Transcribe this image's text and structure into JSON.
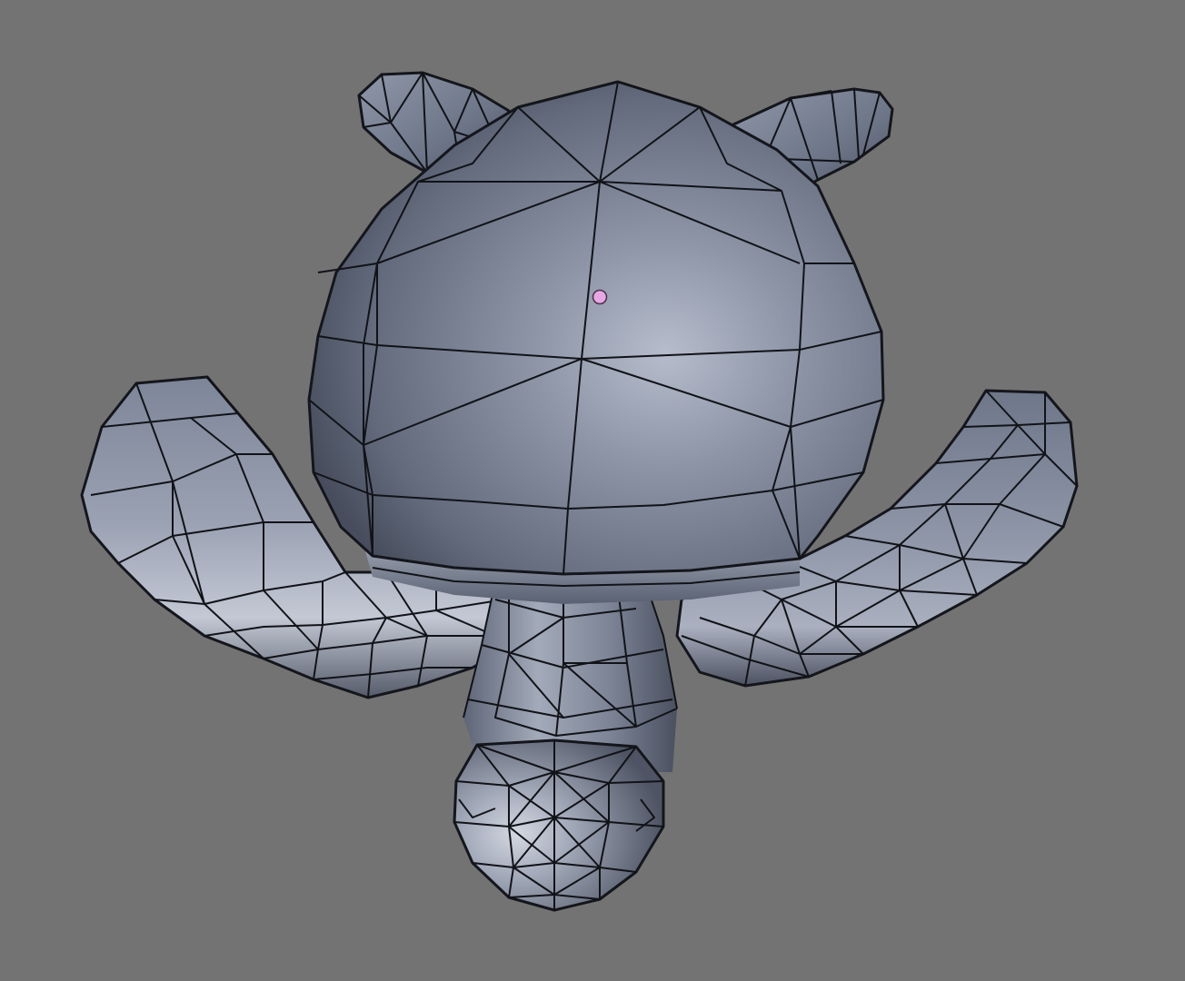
{
  "viewport": {
    "background": "#737373",
    "mesh_base_color": "#6c7384",
    "mesh_highlight_color": "#c9cedb",
    "mesh_shadow_color": "#3a3f4c",
    "wire_color": "#111318",
    "origin_color": "#e7a6e4"
  },
  "object": {
    "mesh_icon": "turtle-mesh"
  }
}
